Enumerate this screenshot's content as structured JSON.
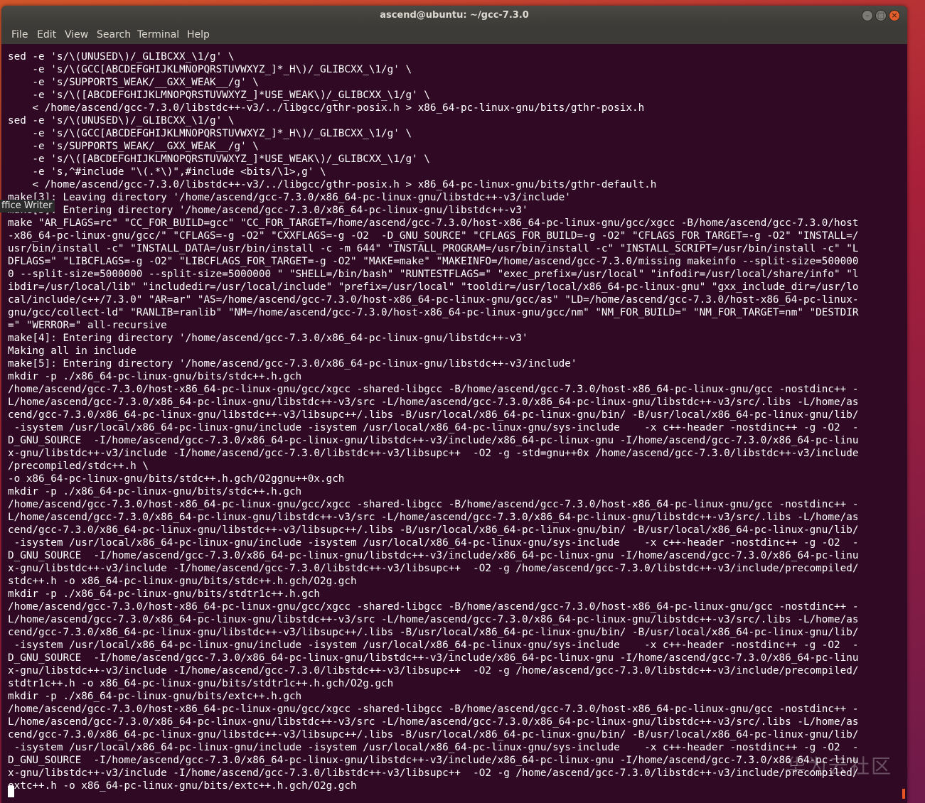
{
  "desktop": {
    "launcher_label": "ffice Writer"
  },
  "window": {
    "title": "ascend@ubuntu: ~/gcc-7.3.0",
    "minimize_glyph": "–",
    "maximize_glyph": "□",
    "close_glyph": "×"
  },
  "menu": {
    "file": "File",
    "edit": "Edit",
    "view": "View",
    "search": "Search",
    "terminal": "Terminal",
    "help": "Help"
  },
  "terminal": {
    "lines": [
      "sed -e 's/\\(UNUSED\\)/_GLIBCXX_\\1/g' \\",
      "    -e 's/\\(GCC[ABCDEFGHIJKLMNOPQRSTUVWXYZ_]*_H\\)/_GLIBCXX_\\1/g' \\",
      "    -e 's/SUPPORTS_WEAK/__GXX_WEAK__/g' \\",
      "    -e 's/\\([ABCDEFGHIJKLMNOPQRSTUVWXYZ_]*USE_WEAK\\)/_GLIBCXX_\\1/g' \\",
      "    < /home/ascend/gcc-7.3.0/libstdc++-v3/../libgcc/gthr-posix.h > x86_64-pc-linux-gnu/bits/gthr-posix.h",
      "sed -e 's/\\(UNUSED\\)/_GLIBCXX_\\1/g' \\",
      "    -e 's/\\(GCC[ABCDEFGHIJKLMNOPQRSTUVWXYZ_]*_H\\)/_GLIBCXX_\\1/g' \\",
      "    -e 's/SUPPORTS_WEAK/__GXX_WEAK__/g' \\",
      "    -e 's/\\([ABCDEFGHIJKLMNOPQRSTUVWXYZ_]*USE_WEAK\\)/_GLIBCXX_\\1/g' \\",
      "    -e 's,^#include \"\\(.*\\)\",#include <bits/\\1>,g' \\",
      "    < /home/ascend/gcc-7.3.0/libstdc++-v3/../libgcc/gthr-posix.h > x86_64-pc-linux-gnu/bits/gthr-default.h",
      "make[3]: Leaving directory '/home/ascend/gcc-7.3.0/x86_64-pc-linux-gnu/libstdc++-v3/include'",
      "make[3]: Entering directory '/home/ascend/gcc-7.3.0/x86_64-pc-linux-gnu/libstdc++-v3'",
      "make \"AR_FLAGS=rc\" \"CC_FOR_BUILD=gcc\" \"CC_FOR_TARGET=/home/ascend/gcc-7.3.0/host-x86_64-pc-linux-gnu/gcc/xgcc -B/home/ascend/gcc-7.3.0/host",
      "-x86_64-pc-linux-gnu/gcc/\" \"CFLAGS=-g -O2\" \"CXXFLAGS=-g -O2  -D_GNU_SOURCE\" \"CFLAGS_FOR_BUILD=-g -O2\" \"CFLAGS_FOR_TARGET=-g -O2\" \"INSTALL=/",
      "usr/bin/install -c\" \"INSTALL_DATA=/usr/bin/install -c -m 644\" \"INSTALL_PROGRAM=/usr/bin/install -c\" \"INSTALL_SCRIPT=/usr/bin/install -c\" \"L",
      "DFLAGS=\" \"LIBCFLAGS=-g -O2\" \"LIBCFLAGS_FOR_TARGET=-g -O2\" \"MAKE=make\" \"MAKEINFO=/home/ascend/gcc-7.3.0/missing makeinfo --split-size=500000",
      "0 --split-size=5000000 --split-size=5000000 \" \"SHELL=/bin/bash\" \"RUNTESTFLAGS=\" \"exec_prefix=/usr/local\" \"infodir=/usr/local/share/info\" \"l",
      "ibdir=/usr/local/lib\" \"includedir=/usr/local/include\" \"prefix=/usr/local\" \"tooldir=/usr/local/x86_64-pc-linux-gnu\" \"gxx_include_dir=/usr/lo",
      "cal/include/c++/7.3.0\" \"AR=ar\" \"AS=/home/ascend/gcc-7.3.0/host-x86_64-pc-linux-gnu/gcc/as\" \"LD=/home/ascend/gcc-7.3.0/host-x86_64-pc-linux-",
      "gnu/gcc/collect-ld\" \"RANLIB=ranlib\" \"NM=/home/ascend/gcc-7.3.0/host-x86_64-pc-linux-gnu/gcc/nm\" \"NM_FOR_BUILD=\" \"NM_FOR_TARGET=nm\" \"DESTDIR",
      "=\" \"WERROR=\" all-recursive",
      "make[4]: Entering directory '/home/ascend/gcc-7.3.0/x86_64-pc-linux-gnu/libstdc++-v3'",
      "Making all in include",
      "make[5]: Entering directory '/home/ascend/gcc-7.3.0/x86_64-pc-linux-gnu/libstdc++-v3/include'",
      "mkdir -p ./x86_64-pc-linux-gnu/bits/stdc++.h.gch",
      "/home/ascend/gcc-7.3.0/host-x86_64-pc-linux-gnu/gcc/xgcc -shared-libgcc -B/home/ascend/gcc-7.3.0/host-x86_64-pc-linux-gnu/gcc -nostdinc++ -",
      "L/home/ascend/gcc-7.3.0/x86_64-pc-linux-gnu/libstdc++-v3/src -L/home/ascend/gcc-7.3.0/x86_64-pc-linux-gnu/libstdc++-v3/src/.libs -L/home/as",
      "cend/gcc-7.3.0/x86_64-pc-linux-gnu/libstdc++-v3/libsupc++/.libs -B/usr/local/x86_64-pc-linux-gnu/bin/ -B/usr/local/x86_64-pc-linux-gnu/lib/",
      " -isystem /usr/local/x86_64-pc-linux-gnu/include -isystem /usr/local/x86_64-pc-linux-gnu/sys-include    -x c++-header -nostdinc++ -g -O2  -",
      "D_GNU_SOURCE  -I/home/ascend/gcc-7.3.0/x86_64-pc-linux-gnu/libstdc++-v3/include/x86_64-pc-linux-gnu -I/home/ascend/gcc-7.3.0/x86_64-pc-linu",
      "x-gnu/libstdc++-v3/include -I/home/ascend/gcc-7.3.0/libstdc++-v3/libsupc++  -O2 -g -std=gnu++0x /home/ascend/gcc-7.3.0/libstdc++-v3/include",
      "/precompiled/stdc++.h \\",
      "-o x86_64-pc-linux-gnu/bits/stdc++.h.gch/O2ggnu++0x.gch",
      "mkdir -p ./x86_64-pc-linux-gnu/bits/stdc++.h.gch",
      "/home/ascend/gcc-7.3.0/host-x86_64-pc-linux-gnu/gcc/xgcc -shared-libgcc -B/home/ascend/gcc-7.3.0/host-x86_64-pc-linux-gnu/gcc -nostdinc++ -",
      "L/home/ascend/gcc-7.3.0/x86_64-pc-linux-gnu/libstdc++-v3/src -L/home/ascend/gcc-7.3.0/x86_64-pc-linux-gnu/libstdc++-v3/src/.libs -L/home/as",
      "cend/gcc-7.3.0/x86_64-pc-linux-gnu/libstdc++-v3/libsupc++/.libs -B/usr/local/x86_64-pc-linux-gnu/bin/ -B/usr/local/x86_64-pc-linux-gnu/lib/",
      " -isystem /usr/local/x86_64-pc-linux-gnu/include -isystem /usr/local/x86_64-pc-linux-gnu/sys-include    -x c++-header -nostdinc++ -g -O2  -",
      "D_GNU_SOURCE  -I/home/ascend/gcc-7.3.0/x86_64-pc-linux-gnu/libstdc++-v3/include/x86_64-pc-linux-gnu -I/home/ascend/gcc-7.3.0/x86_64-pc-linu",
      "x-gnu/libstdc++-v3/include -I/home/ascend/gcc-7.3.0/libstdc++-v3/libsupc++  -O2 -g /home/ascend/gcc-7.3.0/libstdc++-v3/include/precompiled/",
      "stdc++.h -o x86_64-pc-linux-gnu/bits/stdc++.h.gch/O2g.gch",
      "mkdir -p ./x86_64-pc-linux-gnu/bits/stdtr1c++.h.gch",
      "/home/ascend/gcc-7.3.0/host-x86_64-pc-linux-gnu/gcc/xgcc -shared-libgcc -B/home/ascend/gcc-7.3.0/host-x86_64-pc-linux-gnu/gcc -nostdinc++ -",
      "L/home/ascend/gcc-7.3.0/x86_64-pc-linux-gnu/libstdc++-v3/src -L/home/ascend/gcc-7.3.0/x86_64-pc-linux-gnu/libstdc++-v3/src/.libs -L/home/as",
      "cend/gcc-7.3.0/x86_64-pc-linux-gnu/libstdc++-v3/libsupc++/.libs -B/usr/local/x86_64-pc-linux-gnu/bin/ -B/usr/local/x86_64-pc-linux-gnu/lib/",
      " -isystem /usr/local/x86_64-pc-linux-gnu/include -isystem /usr/local/x86_64-pc-linux-gnu/sys-include    -x c++-header -nostdinc++ -g -O2  -",
      "D_GNU_SOURCE  -I/home/ascend/gcc-7.3.0/x86_64-pc-linux-gnu/libstdc++-v3/include/x86_64-pc-linux-gnu -I/home/ascend/gcc-7.3.0/x86_64-pc-linu",
      "x-gnu/libstdc++-v3/include -I/home/ascend/gcc-7.3.0/libstdc++-v3/libsupc++  -O2 -g /home/ascend/gcc-7.3.0/libstdc++-v3/include/precompiled/",
      "stdtr1c++.h -o x86_64-pc-linux-gnu/bits/stdtr1c++.h.gch/O2g.gch",
      "mkdir -p ./x86_64-pc-linux-gnu/bits/extc++.h.gch",
      "/home/ascend/gcc-7.3.0/host-x86_64-pc-linux-gnu/gcc/xgcc -shared-libgcc -B/home/ascend/gcc-7.3.0/host-x86_64-pc-linux-gnu/gcc -nostdinc++ -",
      "L/home/ascend/gcc-7.3.0/x86_64-pc-linux-gnu/libstdc++-v3/src -L/home/ascend/gcc-7.3.0/x86_64-pc-linux-gnu/libstdc++-v3/src/.libs -L/home/as",
      "cend/gcc-7.3.0/x86_64-pc-linux-gnu/libstdc++-v3/libsupc++/.libs -B/usr/local/x86_64-pc-linux-gnu/bin/ -B/usr/local/x86_64-pc-linux-gnu/lib/",
      " -isystem /usr/local/x86_64-pc-linux-gnu/include -isystem /usr/local/x86_64-pc-linux-gnu/sys-include    -x c++-header -nostdinc++ -g -O2  -",
      "D_GNU_SOURCE  -I/home/ascend/gcc-7.3.0/x86_64-pc-linux-gnu/libstdc++-v3/include/x86_64-pc-linux-gnu -I/home/ascend/gcc-7.3.0/x86_64-pc-linu",
      "x-gnu/libstdc++-v3/include -I/home/ascend/gcc-7.3.0/libstdc++-v3/libsupc++  -O2 -g /home/ascend/gcc-7.3.0/libstdc++-v3/include/precompiled/",
      "extc++.h -o x86_64-pc-linux-gnu/bits/extc++.h.gch/O2g.gch"
    ]
  },
  "watermark": "华为云社区",
  "colors": {
    "terminal_bg": "#300a24",
    "terminal_fg": "#ffffff",
    "titlebar_bg": "#3c3b37",
    "close_button": "#e05d2c",
    "accent": "#e95420"
  }
}
